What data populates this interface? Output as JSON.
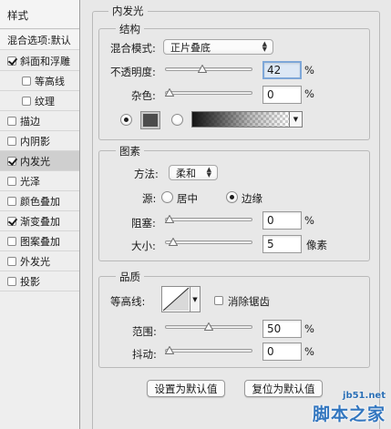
{
  "sidebar": {
    "header": "样式",
    "blend_options": "混合选项:默认",
    "items": [
      {
        "label": "斜面和浮雕",
        "checked": true
      },
      {
        "label": "等高线",
        "checked": false
      },
      {
        "label": "纹理",
        "checked": false
      },
      {
        "label": "描边",
        "checked": false
      },
      {
        "label": "内阴影",
        "checked": false
      },
      {
        "label": "内发光",
        "checked": true
      },
      {
        "label": "光泽",
        "checked": false
      },
      {
        "label": "颜色叠加",
        "checked": false
      },
      {
        "label": "渐变叠加",
        "checked": true
      },
      {
        "label": "图案叠加",
        "checked": false
      },
      {
        "label": "外发光",
        "checked": false
      },
      {
        "label": "投影",
        "checked": false
      }
    ]
  },
  "panel": {
    "title": "内发光",
    "structure": {
      "title": "结构",
      "blend_mode_label": "混合模式:",
      "blend_mode_value": "正片叠底",
      "opacity_label": "不透明度:",
      "opacity_value": "42",
      "noise_label": "杂色:",
      "noise_value": "0",
      "percent": "%",
      "opacity_level": 42,
      "noise_level": 0,
      "color_swatch": "#4c4c4c",
      "color_mode": "solid"
    },
    "elements": {
      "title": "图素",
      "method_label": "方法:",
      "method_value": "柔和",
      "source_label": "源:",
      "source_center": "居中",
      "source_edge": "边缘",
      "source_selected": "edge",
      "choke_label": "阻塞:",
      "choke_value": "0",
      "size_label": "大小:",
      "size_value": "5",
      "size_unit": "像素",
      "percent": "%",
      "choke_level": 0,
      "size_level": 5
    },
    "quality": {
      "title": "品质",
      "contour_label": "等高线:",
      "antialias_label": "消除锯齿",
      "antialias_checked": false,
      "range_label": "范围:",
      "range_value": "50",
      "jitter_label": "抖动:",
      "jitter_value": "0",
      "percent": "%",
      "range_level": 50,
      "jitter_level": 0
    },
    "buttons": {
      "set_default": "设置为默认值",
      "reset_default": "复位为默认值"
    }
  },
  "watermark": {
    "url": "jb51.net",
    "name": "脚本之家"
  },
  "colors": {
    "background": "#e8e8e8",
    "selected_row": "#cfcfcf",
    "focus_ring": "#7ea7d8"
  }
}
